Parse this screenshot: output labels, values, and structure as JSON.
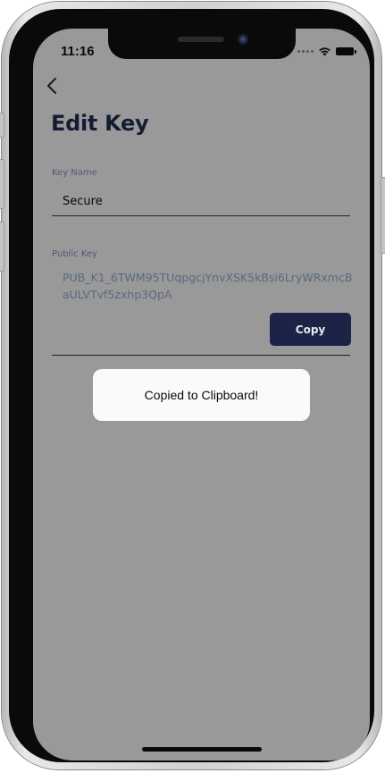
{
  "status_bar": {
    "time": "11:16",
    "icons": [
      "cellular-dots-icon",
      "wifi-icon",
      "battery-icon"
    ]
  },
  "nav": {
    "back_icon": "chevron-left-icon"
  },
  "page": {
    "title": "Edit Key"
  },
  "key_name": {
    "label": "Key Name",
    "value": "Secure"
  },
  "public_key": {
    "label": "Public Key",
    "value": "PUB_K1_6TWM95TUqpgcjYnvXSK5kBsi6LryWRxmcBaULVTvf5zxhp3QpA",
    "copy_label": "Copy"
  },
  "toast": {
    "message": "Copied to Clipboard!"
  },
  "colors": {
    "overlay": "#999999",
    "title": "#141c34",
    "button_bg": "#1b2346",
    "key_text": "#5a6a80",
    "toast_bg": "#fafafa"
  }
}
